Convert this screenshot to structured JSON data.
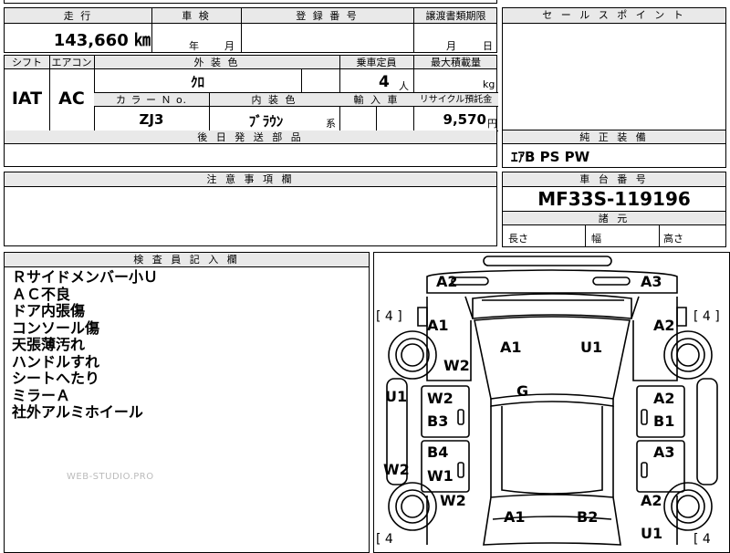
{
  "top_row": {
    "mileage_label": "走 行",
    "shaken_label": "車 検",
    "registration_label": "登 録 番 号",
    "transfer_docs_label": "譲渡書類期限",
    "mileage_value": "143,660 ㎞",
    "shaken_year": "年",
    "shaken_month": "月",
    "transfer_month": "月",
    "transfer_day": "日"
  },
  "sales_point_label": "セ ー ル ス ポ イ ン ト",
  "spec_row": {
    "shift_label": "シフト",
    "aircon_label": "エアコン",
    "exterior_color_label": "外 装 色",
    "capacity_label": "乗車定員",
    "max_load_label": "最大積載量",
    "shift_value": "IAT",
    "aircon_value": "AC",
    "exterior_color_value": "ｸﾛ",
    "capacity_value": "4",
    "capacity_unit": "人",
    "max_load_unit": "kg",
    "color_no_label": "カ ラ ー Ｎ o.",
    "interior_color_label": "内 装 色",
    "import_label": "輸 入 車",
    "recycle_label": "リサイクル預託金",
    "color_no_value": "ZJ3",
    "interior_color_value": "ﾌﾞﾗｳﾝ",
    "interior_suffix": "系",
    "recycle_value": "9,570",
    "recycle_unit": "円"
  },
  "later_parts_label": "後 日 発 送 部 品",
  "equipment": {
    "label": "純 正 装 備",
    "value": "ｴｱB PS PW"
  },
  "caution_label": "注 意 事 項 欄",
  "chassis": {
    "label": "車 台 番 号",
    "value": "MF33S-119196",
    "dimensions_label": "諸 元",
    "length_label": "長さ",
    "width_label": "幅",
    "height_label": "高さ"
  },
  "inspector": {
    "label": "検 査 員 記 入 欄",
    "notes": [
      "Ｒサイドメンバー小Ｕ",
      "ＡＣ不良",
      "ドア内張傷",
      "コンソール傷",
      "天張薄汚れ",
      "ハンドルすれ",
      "シートへたり",
      "ミラーＡ",
      "社外アルミホイール"
    ],
    "watermark": "WEB-STUDIO.PRO"
  },
  "damage_map": {
    "tire_marks": [
      "[ 4 ]",
      "[ 4 ]",
      "[ 4",
      "[ 4"
    ],
    "marks": [
      "A2",
      "A3",
      "A1",
      "A2",
      "A1",
      "U1",
      "W2",
      "G",
      "U1",
      "W2",
      "A2",
      "B3",
      "B1",
      "B4",
      "A3",
      "W2",
      "W1",
      "W2",
      "A2",
      "A1",
      "B2",
      "U1"
    ]
  },
  "colors": {
    "header_bg": "#e9e9e9",
    "border": "#000000"
  }
}
